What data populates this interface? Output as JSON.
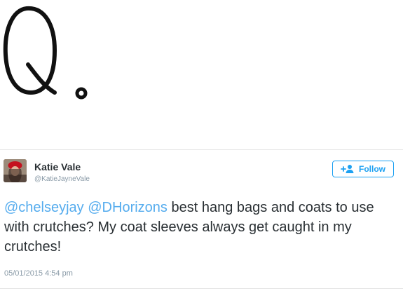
{
  "handwriting": {
    "text": "Q."
  },
  "tweet": {
    "author": {
      "display_name": "Katie Vale",
      "handle": "@KatieJayneVale"
    },
    "follow_button": {
      "label": "Follow"
    },
    "mentions": [
      "@chelseyjay",
      "@DHorizons"
    ],
    "body_text": "best hang bags and coats to use with crutches? My coat sleeves always get caught in my crutches!",
    "timestamp": "05/01/2015 4:54 pm"
  },
  "icons": {
    "follow": "add-person-icon",
    "avatar": "profile-photo"
  },
  "colors": {
    "accent": "#1da1f2",
    "mention": "#55acee",
    "muted": "#8899a6",
    "text": "#292f33"
  }
}
